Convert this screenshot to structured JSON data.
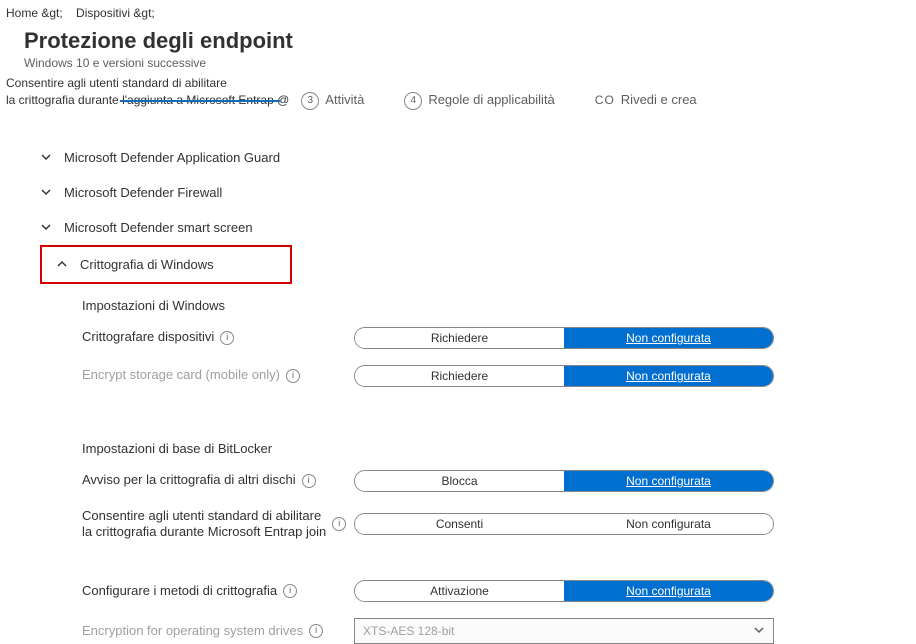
{
  "breadcrumb": {
    "home": "Home &gt;",
    "devices": "Dispositivi &gt;"
  },
  "title": "Protezione degli endpoint",
  "subtitle": "Windows 10 e versioni successive",
  "overlap_line1": "Consentire agli utenti standard di abilitare",
  "overlap_line2": "la crittografia durante l'aggiunta a Microsoft Entrap @",
  "tabs": {
    "activity": "Attività",
    "applicability": "Regole di applicabilità",
    "review": "Rivedi e crea",
    "step3": "3",
    "step4": "4",
    "co": "CO"
  },
  "sections": {
    "appguard": "Microsoft Defender Application Guard",
    "firewall": "Microsoft Defender Firewall",
    "smartscreen": "Microsoft Defender smart screen",
    "winenc": "Crittografia di Windows"
  },
  "headers": {
    "winsettings": "Impostazioni di Windows",
    "bitlocker": "Impostazioni di base di BitLocker"
  },
  "settings": {
    "encryptDevices": {
      "label": "Crittografare dispositivi",
      "opt1": "Richiedere",
      "opt2": "Non configurata"
    },
    "encryptStorage": {
      "label": "Encrypt storage card (mobile only)",
      "opt1": "Richiedere",
      "opt2": "Non configurata"
    },
    "warnOther": {
      "label": "Avviso per la crittografia di altri dischi",
      "opt1": "Blocca",
      "opt2": "Non configurata"
    },
    "allowStd": {
      "line1": "Consentire agli utenti standard di abilitare",
      "line2": "la crittografia durante Microsoft   Entrap join",
      "opt1": "Consenti",
      "opt2": "Non configurata"
    },
    "configMethods": {
      "label": "Configurare i metodi di crittografia",
      "opt1": "Attivazione",
      "opt2": "Non configurata"
    },
    "osDrives": {
      "label": "Encryption for operating system drives",
      "value": "XTS-AES 128-bit"
    }
  }
}
